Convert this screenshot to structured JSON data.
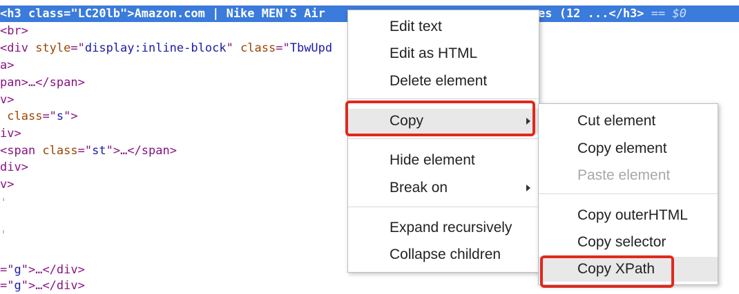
{
  "code_lines": {
    "l0": {
      "open": "<h3 ",
      "attr": "class",
      "eq": "=\"",
      "val": "LC20lb",
      "close": "\">",
      "text": "Amazon.com | Nike MEN'S Air",
      "tail_text": "es (12 ...",
      "end": "</h3>",
      "marker": " == $0"
    },
    "l1": "<br>",
    "l2": {
      "open": "<div ",
      "attr1": "style",
      "val1": "display:inline-block",
      "attr2": "class",
      "val2": "TbwUpd"
    },
    "l3": "a>",
    "l4": "pan>…</span>",
    "l5": "v>",
    "l6": {
      "pre": " ",
      "attr": "class",
      "val": "s",
      "close": ">"
    },
    "l7": "iv>",
    "l8": {
      "open": "<span ",
      "attr": "class",
      "val": "st",
      "close": ">…</span>"
    },
    "l9": "div>",
    "l10": "v>",
    "l11": "'",
    "l12": "'",
    "l13": {
      "pre": "=\"",
      "val": "g",
      "close": "\">…</div>"
    },
    "l14": {
      "pre": "=\"",
      "val": "g",
      "close": "\">…</div>"
    }
  },
  "context_menu": {
    "edit_text": "Edit text",
    "edit_as_html": "Edit as HTML",
    "delete_element": "Delete element",
    "copy": "Copy",
    "hide_element": "Hide element",
    "break_on": "Break on",
    "expand_recursively": "Expand recursively",
    "collapse_children": "Collapse children"
  },
  "copy_submenu": {
    "cut_element": "Cut element",
    "copy_element": "Copy element",
    "paste_element": "Paste element",
    "copy_outerhtml": "Copy outerHTML",
    "copy_selector": "Copy selector",
    "copy_xpath": "Copy XPath"
  },
  "colors": {
    "selection": "#3a7bdb",
    "highlight_box": "#e0281e",
    "menu_hover": "#e8e8e8",
    "disabled_text": "#a8a8a8"
  },
  "icons": {
    "submenu_arrow": "chevron-right-icon"
  }
}
